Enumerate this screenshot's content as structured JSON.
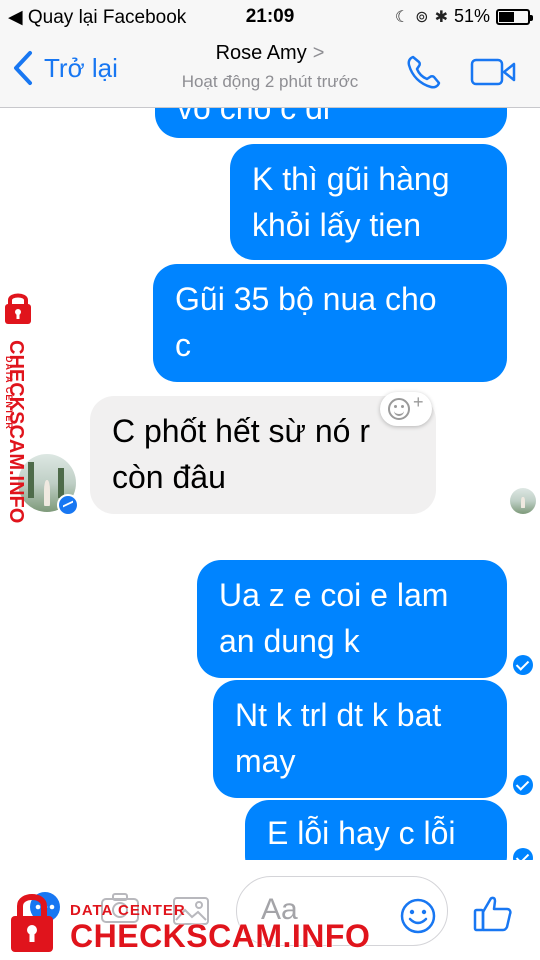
{
  "status_bar": {
    "back_to_app": "Quay lại Facebook",
    "time": "21:09",
    "battery": "51%",
    "icons": [
      "signal-icon",
      "moon-icon",
      "rotation-lock-icon",
      "bluetooth-icon",
      "battery-icon"
    ]
  },
  "nav": {
    "back_label": "Trở lại",
    "title": "Rose Amy",
    "title_chevron": ">",
    "subtitle": "Hoạt động 2 phút trước",
    "icons": [
      "phone-call-icon",
      "video-call-icon"
    ]
  },
  "messages": [
    {
      "from": "me",
      "text": "vo cho c di",
      "partially_visible": true
    },
    {
      "from": "me",
      "line1": "K thì gũi hàng",
      "line2": "khỏi lấy tien"
    },
    {
      "from": "me",
      "line1": "Gũi 35 bộ nua cho",
      "line2": "c"
    },
    {
      "from": "contact",
      "line1": "C phốt hết sừ nó r",
      "line2": "còn đâu"
    },
    {
      "from": "me",
      "line1": "Ua z e coi e lam",
      "line2": "an dung k",
      "status": "sent"
    },
    {
      "from": "me",
      "line1": "Nt k trl dt k bat",
      "line2": "may",
      "status": "sent"
    },
    {
      "from": "me",
      "text": "E lỗi hay c lỗi",
      "status": "sent"
    }
  ],
  "composer": {
    "placeholder": "Aa",
    "icons": [
      "more-icon",
      "camera-icon",
      "photo-icon",
      "emoji-icon",
      "thumbs-up-icon"
    ]
  },
  "watermark": {
    "side_small": "DATA CENTER",
    "side_big": "CHECKSCAM.INFO",
    "bottom_small": "DATA CENTER",
    "bottom_big": "CHECKSCAM.INFO",
    "color": "#e0141c"
  },
  "colors": {
    "accent": "#0084ff",
    "incoming_bubble": "#f1f0f0",
    "bar_bg": "#f7f7f7",
    "ios_blue": "#1877f2"
  }
}
